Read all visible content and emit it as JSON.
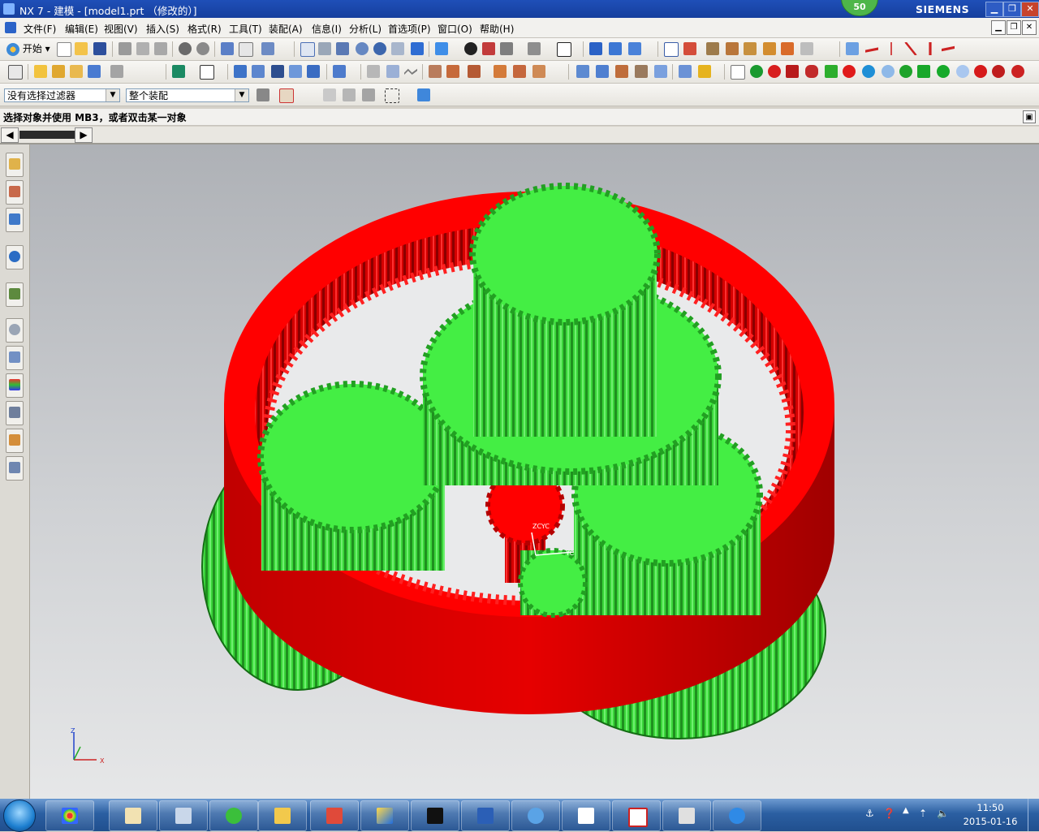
{
  "window": {
    "title": "NX 7 - 建模 - [model1.prt （修改的）]",
    "badge": "50",
    "brand": "SIEMENS",
    "controls": [
      "minimize",
      "restore",
      "close"
    ]
  },
  "menu": {
    "items": [
      "文件(F)",
      "编辑(E)",
      "视图(V)",
      "插入(S)",
      "格式(R)",
      "工具(T)",
      "装配(A)",
      "信息(I)",
      "分析(L)",
      "首选项(P)",
      "窗口(O)",
      "帮助(H)"
    ]
  },
  "toolbar": {
    "start_label": "开始",
    "selection_filter": "没有选择过滤器",
    "selection_scope": "整个装配"
  },
  "status": {
    "message": "选择对象并使用 MB3，或者双击某一对象"
  },
  "viewport": {
    "wcs_label": "ZCYC",
    "wcs_axis": "YC",
    "triad_z": "Z",
    "triad_x": "X"
  },
  "colors": {
    "ring_gear": "#ff0000",
    "planet_gear": "#44ee44",
    "background_top": "#aeb1b6",
    "background_bottom": "#e6e7e8"
  },
  "taskbar": {
    "apps": [
      "paint-icon",
      "calculator-icon",
      "refresh-icon",
      "folder-icon",
      "games-icon",
      "nx-icon",
      "cmd-icon",
      "word-icon",
      "matlab-icon",
      "explorer-icon",
      "pdf-icon",
      "ggg-icon",
      "ie-icon"
    ],
    "time": "11:50",
    "date": "2015-01-16"
  }
}
